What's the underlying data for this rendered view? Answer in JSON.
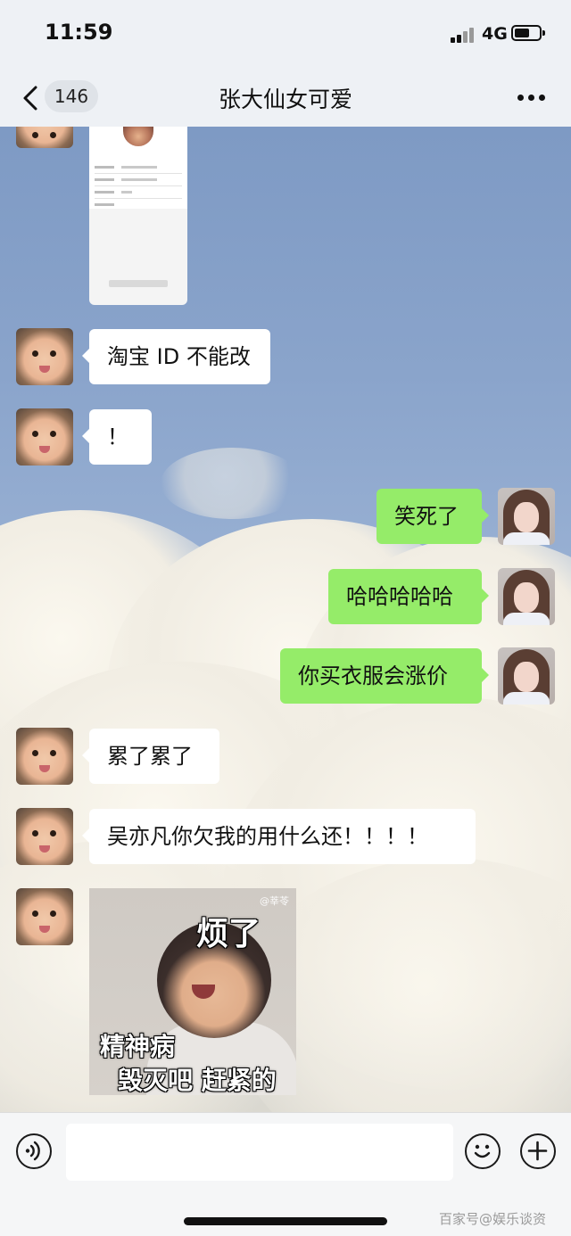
{
  "status_bar": {
    "time": "11:59",
    "network": "4G"
  },
  "nav": {
    "unread_count": "146",
    "title": "张大仙女可爱"
  },
  "messages": [
    {
      "side": "in",
      "text": "淘宝 ID 不能改"
    },
    {
      "side": "in",
      "text": "！"
    },
    {
      "side": "out",
      "text": "笑死了"
    },
    {
      "side": "out",
      "text": "哈哈哈哈哈"
    },
    {
      "side": "out",
      "text": "你买衣服会涨价"
    },
    {
      "side": "in",
      "text": "累了累了"
    },
    {
      "side": "in",
      "text": "吴亦凡你欠我的用什么还！！！！"
    }
  ],
  "sticker": {
    "top_text": "烦了",
    "bottom_line1": "精神病",
    "bottom_line2": "毁灭吧 赶紧的",
    "watermark": "@莘苓"
  },
  "input_bar": {
    "placeholder": ""
  },
  "watermark": "百家号@娱乐谈资"
}
